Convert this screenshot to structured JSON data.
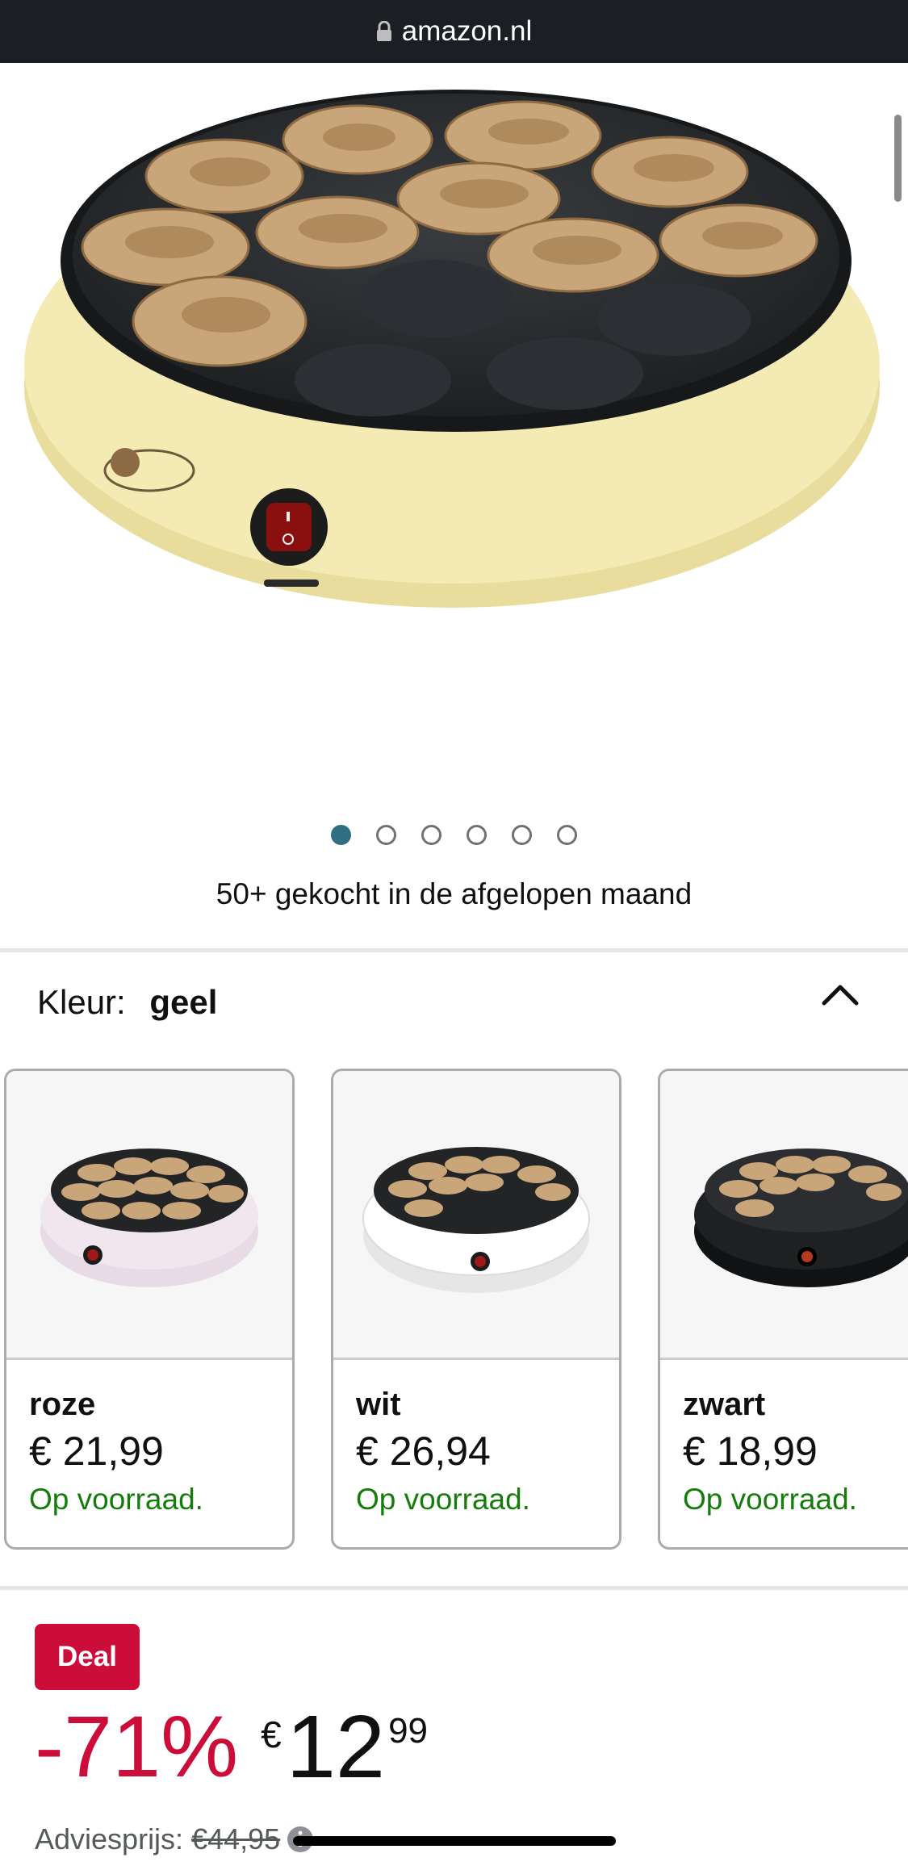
{
  "topbar": {
    "domain": "amazon.nl"
  },
  "gallery": {
    "image_count": 6,
    "active_index": 0,
    "bought_text": "50+ gekocht in de afgelopen maand"
  },
  "variant": {
    "label": "Kleur:",
    "selected": "geel",
    "options": [
      {
        "name": "roze",
        "price": "€ 21,99",
        "stock": "Op voorraad.",
        "color": "#f1e5ee"
      },
      {
        "name": "wit",
        "price": "€ 26,94",
        "stock": "Op voorraad.",
        "color": "#ffffff"
      },
      {
        "name": "zwart",
        "price": "€ 18,99",
        "stock": "Op voorraad.",
        "color": "#1f2022"
      }
    ]
  },
  "deal": {
    "badge": "Deal",
    "discount": "-71%",
    "currency": "€",
    "price_whole": "12",
    "price_fraction": "99",
    "list_label": "Adviesprijs:",
    "list_price": "€44,95"
  },
  "colors": {
    "deal_red": "#cc0c39",
    "stock_green": "#147c0a",
    "active_dot": "#2f6e83",
    "appliance_yellow": "#f4eab4"
  }
}
